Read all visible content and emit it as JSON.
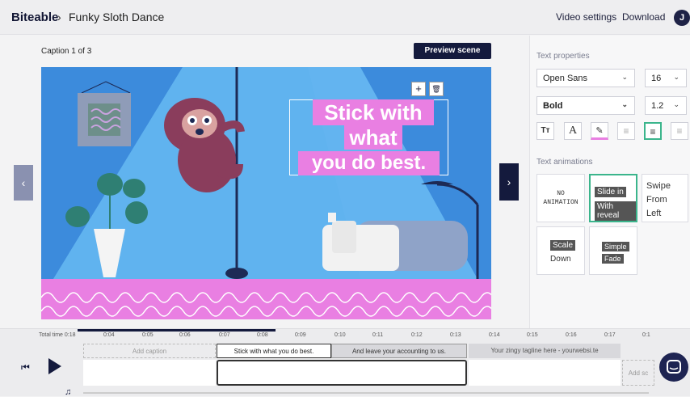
{
  "header": {
    "brand": "Biteable",
    "separator": "›",
    "project_title": "Funky Sloth Dance",
    "video_settings": "Video settings",
    "download": "Download",
    "avatar_initial": "J"
  },
  "stage": {
    "caption_counter": "Caption 1 of 3",
    "preview_button": "Preview scene",
    "prev_arrow": "‹",
    "next_arrow": "›",
    "scene_text_lines": [
      "Stick with",
      "what",
      "you do best."
    ],
    "add_icon": "+",
    "delete_icon": "🗑"
  },
  "panel": {
    "text_properties_heading": "Text properties",
    "font_family": "Open Sans",
    "font_size": "16",
    "font_weight": "Bold",
    "line_height": "1.2",
    "text_animations_heading": "Text animations",
    "animations": [
      {
        "label": "NO ANIMATION"
      },
      {
        "label_top": "Slide in",
        "label_bottom": "With reveal"
      },
      {
        "label": "Swipe From Left"
      },
      {
        "label_top": "Scale",
        "label_bottom": "Down"
      },
      {
        "label_top": "Simple",
        "label_bottom": "Fade"
      }
    ]
  },
  "timeline": {
    "total_time": "Total time 0:18",
    "ticks": [
      "0:04",
      "0:05",
      "0:06",
      "0:07",
      "0:08",
      "0:09",
      "0:10",
      "0:11",
      "0:12",
      "0:13",
      "0:14",
      "0:15",
      "0:16",
      "0:17",
      "0:1"
    ],
    "add_caption": "Add caption",
    "caption_1": "Stick with what you do best.",
    "caption_2": "And leave your accounting to us.",
    "caption_3": "Your zingy tagline here - yourwebsi.te",
    "add_scene": "Add sc"
  },
  "colors": {
    "accent_dark": "#141a3d",
    "pink": "#e97fe2",
    "sky": "#3c8bdc",
    "selected_green": "#3bb58c"
  }
}
